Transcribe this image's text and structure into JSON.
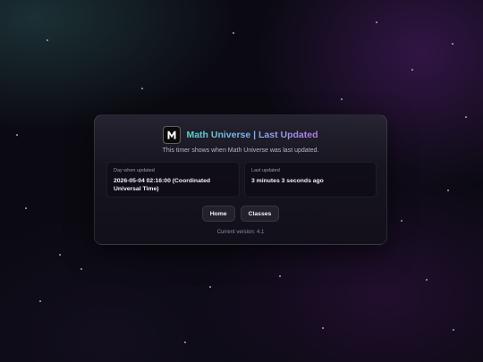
{
  "header": {
    "logo_letter": "M",
    "title": "Math Universe | Last Updated",
    "subtitle": "This timer shows when Math Universe was last updated."
  },
  "info": {
    "day_label": "Day when updated",
    "day_value": "2026-05-04 02:16:00 (Coordinated Universal Time)",
    "last_label": "Last updated",
    "last_value": "3 minutes 3 seconds ago"
  },
  "buttons": {
    "home_label": "Home",
    "classes_label": "Classes"
  },
  "footer": {
    "version_text": "Current version: 4.1"
  },
  "colors": {
    "title_gradient_start": "#5fd3c8",
    "title_gradient_end": "#b57be8",
    "background": "#0b0a12"
  }
}
